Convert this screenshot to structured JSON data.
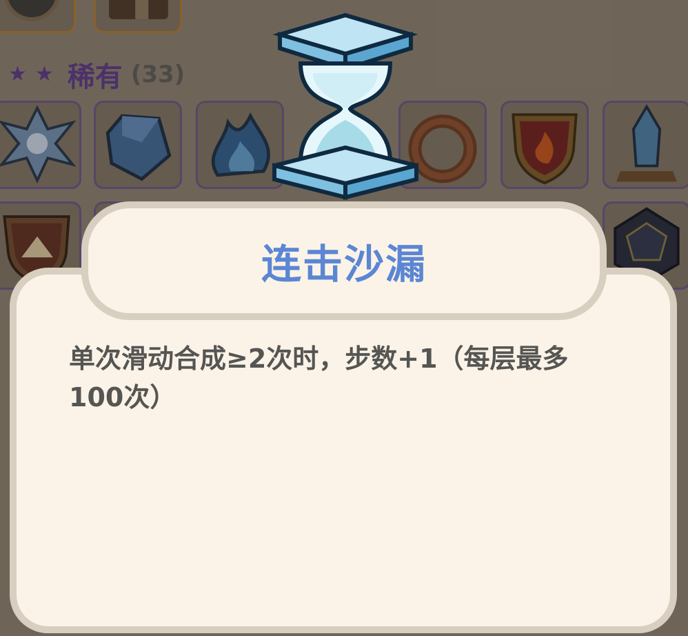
{
  "section": {
    "stars": [
      "★",
      "★"
    ],
    "label": "稀有",
    "count": "(33)"
  },
  "popup": {
    "title": "连击沙漏",
    "description": "单次滑动合成≥2次时，步数+1（每层最多100次）"
  },
  "icons": {
    "featured": "hourglass-icon",
    "grid": [
      "ice-crystal-icon",
      "blue-gem-icon",
      "blue-flame-icon",
      "hourglass-icon",
      "bronze-ring-icon",
      "fire-shield-icon",
      "crystal-tower-icon",
      "mountain-shield-icon",
      "d12-dice-icon"
    ]
  },
  "colors": {
    "rarity": "#5b3a8c",
    "title": "#5b86d4",
    "panel": "#fbf3e7",
    "panel_border": "#d8cfc0"
  }
}
